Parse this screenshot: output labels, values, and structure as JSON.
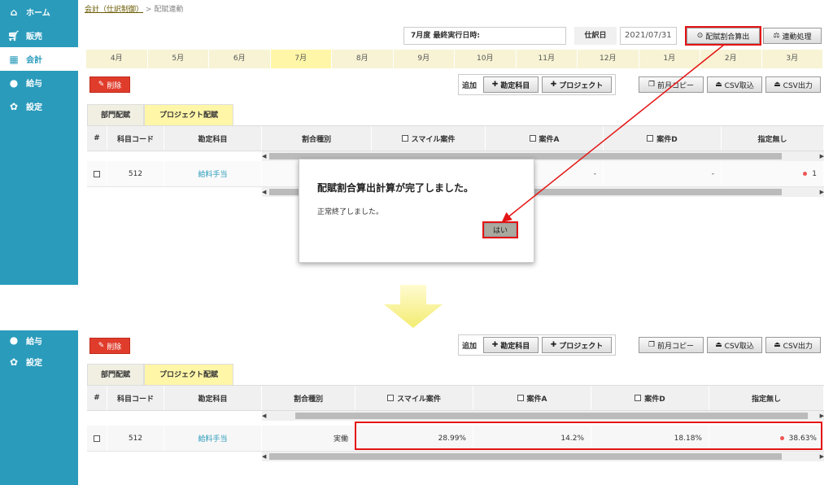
{
  "sidebar": {
    "items": [
      {
        "label": "ホーム",
        "icon": "home-icon"
      },
      {
        "label": "販売",
        "icon": "cart-icon"
      },
      {
        "label": "会計",
        "icon": "calculator-icon"
      },
      {
        "label": "給与",
        "icon": "money-bag-icon"
      },
      {
        "label": "設定",
        "icon": "gear-icon"
      }
    ],
    "lower_items": [
      {
        "label": "給与",
        "icon": "money-bag-icon"
      },
      {
        "label": "設定",
        "icon": "gear-icon"
      }
    ]
  },
  "breadcrumb": {
    "parent": "会計（仕訳制御）",
    "sep": ">",
    "current": "配賦連動"
  },
  "header": {
    "last_run_label": "7月度 最終実行日時:",
    "date_label": "仕訳日",
    "date_value": "2021/07/31",
    "calc_button": "配賦割合算出",
    "link_button": "連動処理"
  },
  "months": [
    "4月",
    "5月",
    "6月",
    "7月",
    "8月",
    "9月",
    "10月",
    "11月",
    "12月",
    "1月",
    "2月",
    "3月"
  ],
  "toolbar": {
    "delete": "削除",
    "add_label": "追加",
    "add_account": "勘定科目",
    "add_project": "プロジェクト",
    "copy_prev": "前月コピー",
    "csv_import": "CSV取込",
    "csv_export": "CSV出力"
  },
  "tabs": {
    "dept": "部門配賦",
    "project": "プロジェクト配賦"
  },
  "table": {
    "headers": {
      "hash": "#",
      "code": "科目コード",
      "account": "勘定科目",
      "type": "割合種別",
      "col1": "スマイル案件",
      "col2": "案件A",
      "col3": "案件D",
      "col4": "指定無し"
    },
    "before": {
      "code": "512",
      "account": "給料手当",
      "col2": "-",
      "col3": "-",
      "col4": "1"
    },
    "after": {
      "code": "512",
      "account": "給料手当",
      "type": "実働",
      "col1": "28.99%",
      "col2": "14.2%",
      "col3": "18.18%",
      "col4": "38.63%"
    }
  },
  "dialog": {
    "title": "配賦割合算出計算が完了しました。",
    "message": "正常終了しました。",
    "ok": "はい"
  },
  "colors": {
    "sidebar": "#2a9bbb",
    "highlight": "#e41414",
    "tab_active": "#fff6a8",
    "delete": "#e03c2c"
  }
}
